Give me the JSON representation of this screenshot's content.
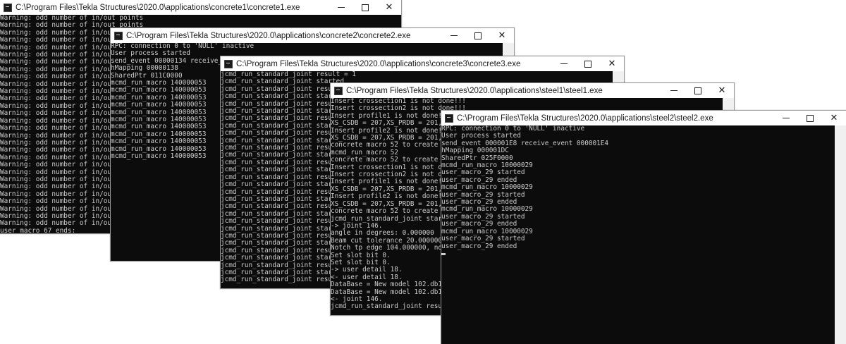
{
  "windows": [
    {
      "id": "concrete1",
      "title": "C:\\Program Files\\Tekla Structures\\2020.0\\applications\\concrete1\\concrete1.exe",
      "lines": [
        "Warning: odd number of in/out points",
        "Warning: odd number of in/out points",
        "Warning: odd number of in/out poi",
        "Warning: odd number of in/out poi",
        "Warning: odd number of in/out poi",
        "Warning: odd number of in/out poi",
        "Warning: odd number of in/out poi",
        "Warning: odd number of in/out poi",
        "Warning: odd number of in/out poi",
        "Warning: odd number of in/out poi",
        "Warning: odd number of in/out poi",
        "Warning: odd number of in/out poi",
        "Warning: odd number of in/out poi",
        "Warning: odd number of in/out poi",
        "Warning: odd number of in/out poi",
        "Warning: odd number of in/out poi",
        "Warning: odd number of in/out poi",
        "Warning: odd number of in/out poi",
        "Warning: odd number of in/out poi",
        "Warning: odd number of in/out poi",
        "Warning: odd number of in/out poi",
        "Warning: odd number of in/out poi",
        "Warning: odd number of in/out poi",
        "Warning: odd number of in/out poi",
        "Warning: odd number of in/out poi",
        "Warning: odd number of in/out poi",
        "Warning: odd number of in/out poi",
        "Warning: odd number of in/out poi",
        "Warning: odd number of in/out poi",
        "user_macro_67 ends:"
      ]
    },
    {
      "id": "concrete2",
      "title": "C:\\Program Files\\Tekla Structures\\2020.0\\applications\\concrete2\\concrete2.exe",
      "lines": [
        "RPC: connection 0 to 'NULL' inactive",
        "User process started",
        "send_event 00000134 receive_event",
        "hMapping 00000138",
        "SharedPtr 011C0000",
        "mcmd_run_macro 140000053",
        "mcmd_run_macro 140000053",
        "mcmd_run_macro 140000053",
        "mcmd_run_macro 140000053",
        "mcmd_run_macro 140000053",
        "mcmd_run_macro 140000053",
        "mcmd_run_macro 140000053",
        "mcmd_run_macro 140000053",
        "mcmd_run_macro 140000053",
        "mcmd_run_macro 140000053",
        "mcmd_run_macro 140000053"
      ]
    },
    {
      "id": "concrete3",
      "title": "C:\\Program Files\\Tekla Structures\\2020.0\\applications\\concrete3\\concrete3.exe",
      "lines": [
        "jcmd_run_standard_joint result = 1",
        "jcmd_run_standard_joint started",
        "jcmd_run_standard_joint result =",
        "jcmd_run_standard_joint started",
        "jcmd_run_standard_joint result =",
        "jcmd_run_standard_joint started",
        "jcmd_run_standard_joint result =",
        "jcmd_run_standard_joint started",
        "jcmd_run_standard_joint result =",
        "jcmd_run_standard_joint started",
        "jcmd_run_standard_joint result =",
        "jcmd_run_standard_joint started",
        "jcmd_run_standard_joint result =",
        "jcmd_run_standard_joint started",
        "jcmd_run_standard_joint result =",
        "jcmd_run_standard_joint started",
        "jcmd_run_standard_joint result =",
        "jcmd_run_standard_joint started",
        "jcmd_run_standard_joint result =",
        "jcmd_run_standard_joint started",
        "jcmd_run_standard_joint result =",
        "jcmd_run_standard_joint started",
        "jcmd_run_standard_joint result =",
        "jcmd_run_standard_joint started",
        "jcmd_run_standard_joint result =",
        "jcmd_run_standard_joint started",
        "jcmd_run_standard_joint result =",
        "jcmd_run_standard_joint started",
        "jcmd_run_standard_joint result ="
      ]
    },
    {
      "id": "steel1",
      "title": "C:\\Program Files\\Tekla Structures\\2020.0\\applications\\steel1\\steel1.exe",
      "lines": [
        "Insert crossection1 is not done!!!",
        "Insert crossection2 is not done!!!",
        "Insert profile1 is not done!!!",
        "XS_CSDB = 207,XS_PRDB = 201,DB_SA",
        "Insert profile2 is not done!!!",
        "XS_CSDB = 207,XS_PRDB = 201,DB_SA",
        "concrete macro 52 to create beam",
        "mcmd_run_macro 52",
        "concrete macro 52 to create beam",
        "Insert crossection1 is not done!!",
        "Insert crossection2 is not done!!",
        "Insert profile1 is not done!!!",
        "XS_CSDB = 207,XS_PRDB = 201,DB_SA",
        "Insert profile2 is not done!!!",
        "XS_CSDB = 207,XS_PRDB = 201,DB_SA",
        "concrete macro 52 to create beam",
        "jcmd_run_standard_joint started",
        "-> joint 146.",
        "angle in degrees: 0.000000",
        "Beam cut tolerance 20.000000, slo",
        "Notch tp edge 104.000000, notch b",
        "Set slot bit 0.",
        "Set slot bit 0.",
        "-> user detail 18.",
        "<- user detail 18.",
        "DataBase = New model 102.db1, Dir",
        "DataBase = New model 102.db1, Dir",
        "<- joint 146.",
        "jcmd_run_standard_joint result = 1"
      ]
    },
    {
      "id": "steel2",
      "title": "C:\\Program Files\\Tekla Structures\\2020.0\\applications\\steel2\\steel2.exe",
      "lines": [
        "RPC: connection 0 to 'NULL' inactive",
        "User process started",
        "send_event 000001E8 receive_event 000001E4",
        "hMapping 000001DC",
        "SharedPtr 025F0000",
        "mcmd_run_macro 10000029",
        "user_macro_29 started",
        "user_macro_29 ended",
        "mcmd_run_macro 10000029",
        "user_macro_29 started",
        "user_macro_29 ended",
        "mcmd_run_macro 10000029",
        "user_macro_29 started",
        "user_macro_29 ended",
        "mcmd_run_macro 10000029",
        "user_macro_29 started",
        "user_macro_29 ended"
      ]
    }
  ],
  "controls": {
    "minimize": "—",
    "maximize": "☐",
    "close": "✕"
  }
}
